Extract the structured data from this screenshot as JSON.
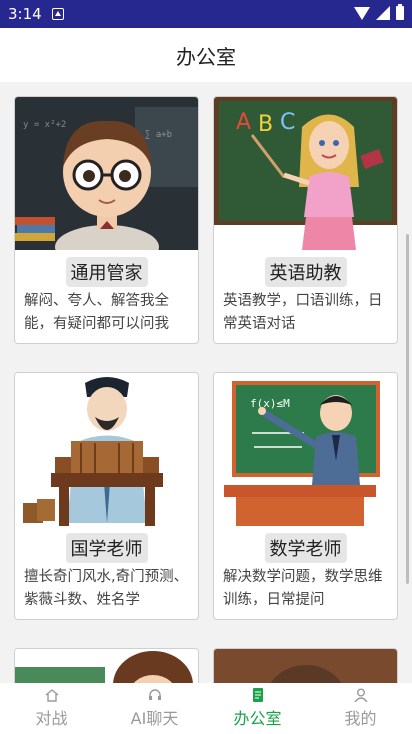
{
  "status": {
    "time": "3:14"
  },
  "header": {
    "title": "办公室"
  },
  "cards": [
    {
      "name": "通用管家",
      "desc": "解闷、夸人、解答我全能，有疑问都可以问我"
    },
    {
      "name": "英语助教",
      "desc": "英语教学，口语训练，日常英语对话"
    },
    {
      "name": "国学老师",
      "desc": "擅长奇门风水,奇门预测、紫薇斗数、姓名学"
    },
    {
      "name": "数学老师",
      "desc": "解决数学问题，数学思维训练，日常提问"
    }
  ],
  "blackboard_text": {
    "letters_a": "A",
    "letters_b": "B",
    "letters_c": "C",
    "math": "f(x)≤M"
  },
  "nav": [
    {
      "label": "对战"
    },
    {
      "label": "AI聊天"
    },
    {
      "label": "办公室"
    },
    {
      "label": "我的"
    }
  ],
  "colors": {
    "status_bar": "#26288f",
    "active_tab": "#19a24a",
    "inactive_tab": "#9a9a9a"
  }
}
